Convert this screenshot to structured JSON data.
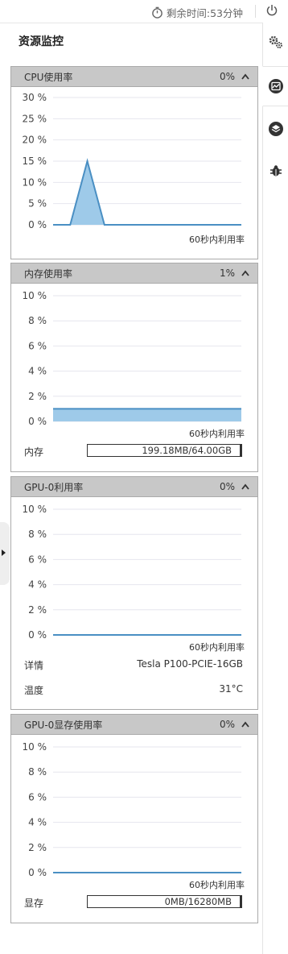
{
  "header": {
    "remaining_time": "剩余时间:53分钟"
  },
  "page_title": "资源监控",
  "rail": {
    "icons": [
      "gears-icon",
      "monitor-chart-icon",
      "layers-icon",
      "bug-icon"
    ]
  },
  "colors": {
    "fill": "#9ecae9",
    "line": "#4a8fc3",
    "header_bg": "#c8c8c8"
  },
  "panels": {
    "cpu": {
      "title": "CPU使用率",
      "percent": "0%",
      "y_labels": [
        "30 %",
        "25 %",
        "20 %",
        "15 %",
        "10 %",
        "5 %",
        "0 %"
      ],
      "note": "60秒内利用率"
    },
    "mem": {
      "title": "内存使用率",
      "percent": "1%",
      "y_labels": [
        "10 %",
        "8 %",
        "6 %",
        "4 %",
        "2 %",
        "0 %"
      ],
      "note": "60秒内利用率",
      "row_label": "内存",
      "bar_text": "199.18MB/64.00GB"
    },
    "gpu": {
      "title": "GPU-0利用率",
      "percent": "0%",
      "y_labels": [
        "10 %",
        "8 %",
        "6 %",
        "4 %",
        "2 %",
        "0 %"
      ],
      "note": "60秒内利用率",
      "detail_label": "详情",
      "detail_value": "Tesla P100-PCIE-16GB",
      "temp_label": "温度",
      "temp_value": "31°C"
    },
    "gpumem": {
      "title": "GPU-0显存使用率",
      "percent": "0%",
      "y_labels": [
        "10 %",
        "8 %",
        "6 %",
        "4 %",
        "2 %",
        "0 %"
      ],
      "note": "60秒内利用率",
      "row_label": "显存",
      "bar_text": "0MB/16280MB"
    }
  },
  "chart_data": [
    {
      "type": "area",
      "title": "CPU使用率",
      "xlabel": "60秒内利用率",
      "ylabel": "",
      "ylim": [
        0,
        30
      ],
      "x": [
        0,
        1,
        2,
        3,
        4,
        5,
        6,
        7,
        8,
        9,
        10,
        11
      ],
      "series": [
        {
          "values": [
            0,
            0,
            15,
            0,
            0,
            0,
            0,
            0,
            0,
            0,
            0,
            0
          ]
        }
      ]
    },
    {
      "type": "area",
      "title": "内存使用率",
      "xlabel": "60秒内利用率",
      "ylabel": "",
      "ylim": [
        0,
        10
      ],
      "x": [
        0,
        1,
        2,
        3,
        4,
        5,
        6,
        7,
        8,
        9,
        10,
        11
      ],
      "series": [
        {
          "values": [
            1,
            1,
            1,
            1,
            1,
            1,
            1,
            1,
            1,
            1,
            1,
            1
          ]
        }
      ]
    },
    {
      "type": "area",
      "title": "GPU-0利用率",
      "xlabel": "60秒内利用率",
      "ylabel": "",
      "ylim": [
        0,
        10
      ],
      "x": [
        0,
        1,
        2,
        3,
        4,
        5,
        6,
        7,
        8,
        9,
        10,
        11
      ],
      "series": [
        {
          "values": [
            0,
            0,
            0,
            0,
            0,
            0,
            0,
            0,
            0,
            0,
            0,
            0
          ]
        }
      ]
    },
    {
      "type": "area",
      "title": "GPU-0显存使用率",
      "xlabel": "60秒内利用率",
      "ylabel": "",
      "ylim": [
        0,
        10
      ],
      "x": [
        0,
        1,
        2,
        3,
        4,
        5,
        6,
        7,
        8,
        9,
        10,
        11
      ],
      "series": [
        {
          "values": [
            0,
            0,
            0,
            0,
            0,
            0,
            0,
            0,
            0,
            0,
            0,
            0
          ]
        }
      ]
    }
  ]
}
